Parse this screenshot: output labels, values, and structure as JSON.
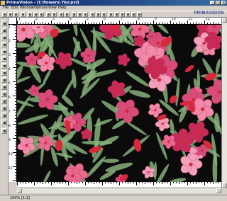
{
  "window": {
    "title": "PrimaVision - [I:\\flowers\\ flor.pvi]",
    "buttons": [
      "_",
      "□",
      "×"
    ]
  },
  "menubar": {
    "items": [
      "File",
      "Edit",
      "Window",
      "Options",
      "View",
      "Help"
    ]
  },
  "brand": {
    "logo": "PRIMAVISION"
  },
  "rulers": {
    "top_labels": [
      "1",
      "2",
      "3",
      "4",
      "5",
      "6",
      "7",
      "8",
      "9",
      "10",
      "11",
      "12"
    ],
    "left_labels": [
      "1",
      "2",
      "3",
      "4",
      "5",
      "6",
      "7",
      "8",
      "9",
      "10",
      "11"
    ]
  },
  "canvas": {
    "background": "#0b0b0b",
    "petal_colors": [
      "#e86a8c",
      "#f08aa8",
      "#d94c7a",
      "#f3a0ba",
      "#c82a56"
    ],
    "leaf_color": "#86b07a",
    "accent_red": "#d8283c"
  },
  "status": {
    "zoom": "100% [1:1]"
  }
}
